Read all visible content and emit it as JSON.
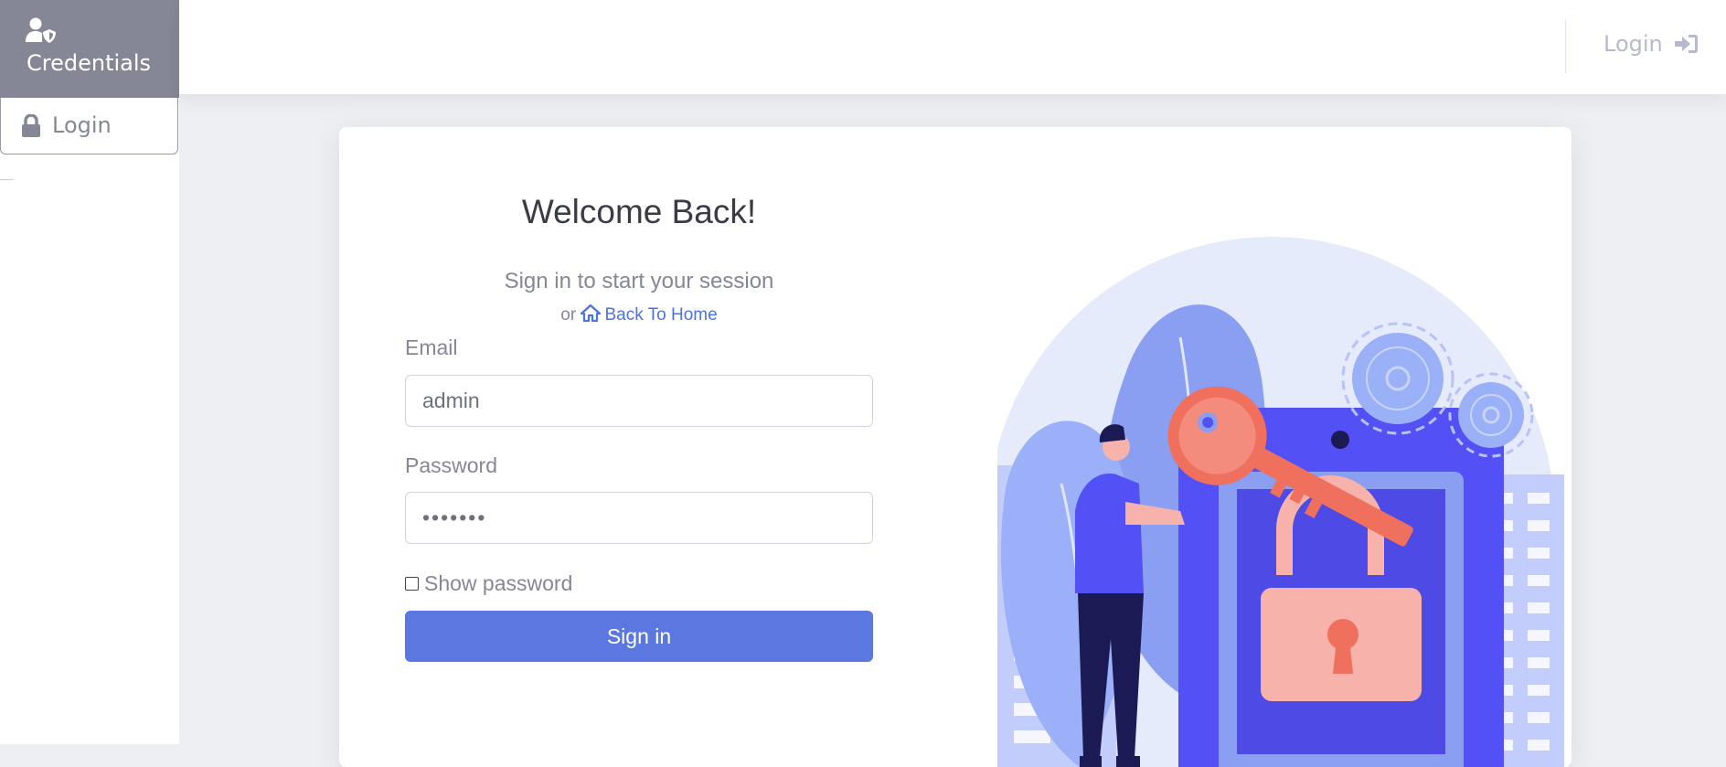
{
  "sidebar": {
    "brand_label": "Credentials",
    "brand_icon": "user-shield-icon",
    "items": [
      {
        "label": "Login",
        "icon": "lock-icon"
      }
    ]
  },
  "topbar": {
    "login_label": "Login",
    "login_icon": "sign-in-icon"
  },
  "login_card": {
    "title": "Welcome Back!",
    "subtitle": "Sign in to start your session",
    "or_text": "or",
    "back_home_label": "Back To Home",
    "back_home_icon": "home-icon",
    "email_label": "Email",
    "email_value": "admin",
    "password_label": "Password",
    "password_value": "•••••••",
    "show_password_label": "Show password",
    "show_password_checked": false,
    "sign_in_label": "Sign in"
  },
  "colors": {
    "brand_bg": "#858796",
    "primary": "#4e73df",
    "button": "#5a78e0",
    "illustration_purple": "#5350f5",
    "illustration_key": "#f0705e"
  }
}
